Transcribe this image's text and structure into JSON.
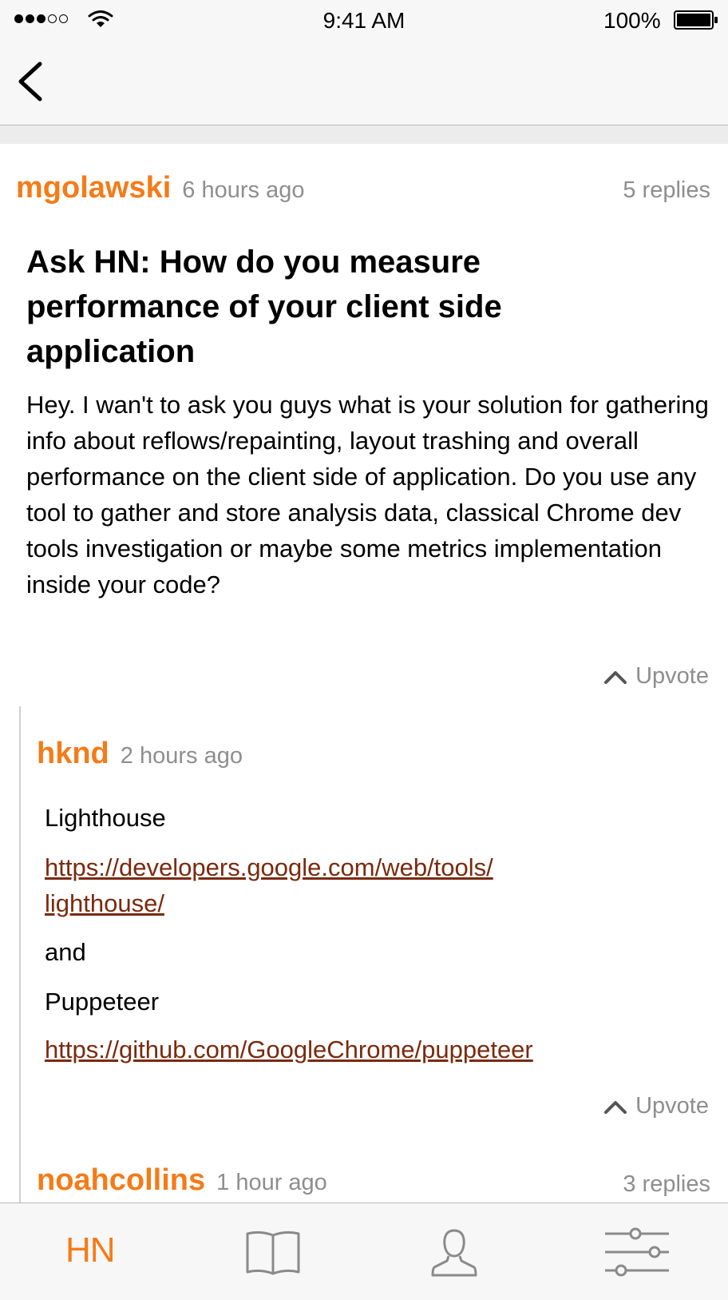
{
  "status_bar": {
    "time": "9:41 AM",
    "battery": "100%"
  },
  "story": {
    "author": "mgolawski",
    "time": "6 hours ago",
    "replies": "5 replies",
    "title": "Ask HN: How do you measure performance of your client side application",
    "body": "Hey. I wan't to ask you guys what is your solution for gathering info about reflows/repainting, layout trashing and overall performance on the client side of application. Do you use any tool to gather and store analysis data, classical Chrome dev tools investigation or maybe some metrics implementation inside your code?",
    "upvote_label": "Upvote"
  },
  "comments": [
    {
      "author": "hknd",
      "time": "2 hours ago",
      "line1": "Lighthouse",
      "link1_a": "https://developers.google.com/web/tools/",
      "link1_b": "lighthouse/",
      "line2": "and",
      "line3": "Puppeteer",
      "link2": "https://github.com/GoogleChrome/puppeteer",
      "upvote_label": "Upvote"
    },
    {
      "author": "noahcollins",
      "time": "1 hour ago",
      "replies": "3 replies"
    }
  ],
  "tab_bar": {
    "tabs": [
      {
        "label": "HN",
        "icon": "hn-text-icon",
        "active": true
      },
      {
        "icon": "book-icon"
      },
      {
        "icon": "person-icon"
      },
      {
        "icon": "sliders-icon"
      }
    ]
  },
  "colors": {
    "accent": "#f57b18",
    "link": "#7a2a0e",
    "meta": "#8e8e8e"
  }
}
